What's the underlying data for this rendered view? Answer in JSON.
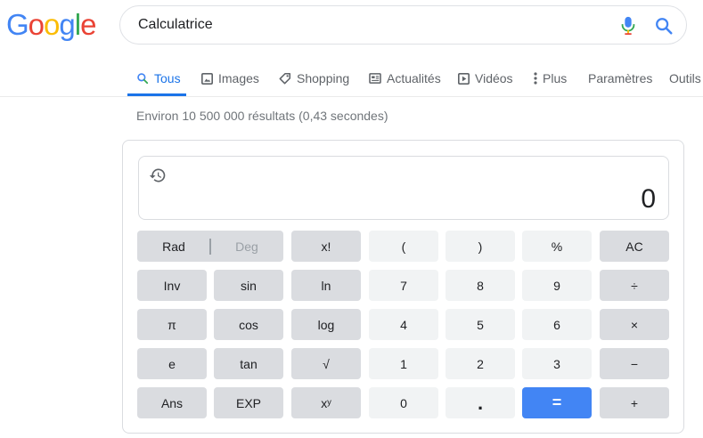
{
  "logo": {
    "letters": [
      "G",
      "o",
      "o",
      "g",
      "l",
      "e"
    ],
    "colors": [
      "#4285f4",
      "#ea4335",
      "#fbbc05",
      "#4285f4",
      "#34a853",
      "#ea4335"
    ]
  },
  "search": {
    "query": "Calculatrice",
    "mic_icon": "mic-icon",
    "search_icon": "search-icon"
  },
  "tabs": [
    {
      "label": "Tous",
      "icon": "search-icon",
      "active": true
    },
    {
      "label": "Images",
      "icon": "image-icon"
    },
    {
      "label": "Shopping",
      "icon": "tag-icon"
    },
    {
      "label": "Actualités",
      "icon": "newspaper-icon"
    },
    {
      "label": "Vidéos",
      "icon": "play-icon"
    },
    {
      "label": "Plus",
      "icon": "more-vert-icon"
    },
    {
      "label": "Paramètres"
    },
    {
      "label": "Outils"
    }
  ],
  "results_count": "Environ 10 500 000 résultats (0,43 secondes)",
  "calculator": {
    "display_value": "0",
    "history_icon": "history-icon",
    "keys": {
      "rad": "Rad",
      "deg": "Deg",
      "fact": "x!",
      "lparen": "(",
      "rparen": ")",
      "percent": "%",
      "ac": "AC",
      "inv": "Inv",
      "sin": "sin",
      "ln": "ln",
      "k7": "7",
      "k8": "8",
      "k9": "9",
      "divide": "÷",
      "pi": "π",
      "cos": "cos",
      "log": "log",
      "k4": "4",
      "k5": "5",
      "k6": "6",
      "times": "×",
      "e": "e",
      "tan": "tan",
      "sqrt": "√",
      "k1": "1",
      "k2": "2",
      "k3": "3",
      "minus": "−",
      "ans": "Ans",
      "exp": "EXP",
      "pow": "xʸ",
      "k0": "0",
      "dot": ".",
      "equals": "=",
      "plus": "+"
    }
  },
  "colors": {
    "accent": "#1a73e8",
    "equals_bg": "#4285f4",
    "fn_key": "#dadce0",
    "num_key": "#f1f3f4"
  }
}
